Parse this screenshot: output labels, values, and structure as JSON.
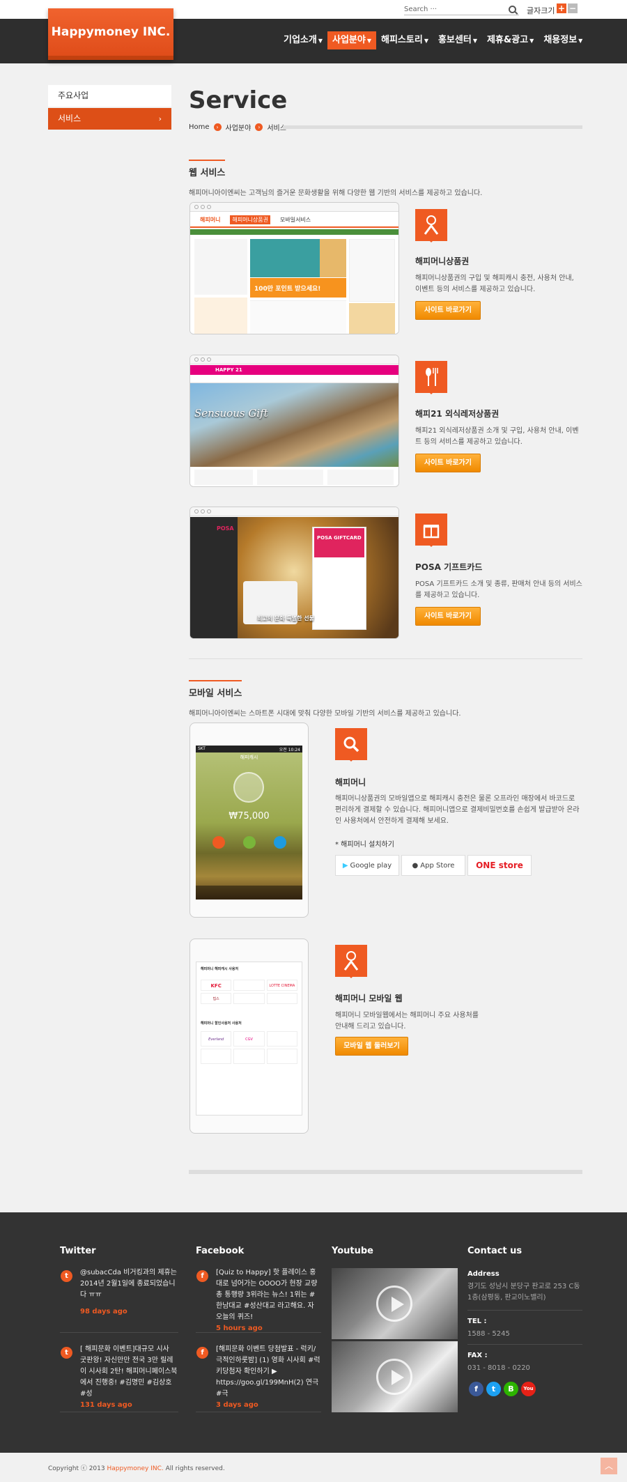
{
  "topbar": {
    "search_placeholder": "Search ···",
    "fontsize_label": "글자크기",
    "plus": "+",
    "minus": "−"
  },
  "header": {
    "logo": "Happymoney INC.",
    "nav": [
      "기업소개",
      "사업분야",
      "해피스토리",
      "홍보센터",
      "제휴&광고",
      "채용정보"
    ],
    "active_index": 1
  },
  "sidebar": {
    "items": [
      {
        "label": "주요사업"
      },
      {
        "label": "서비스"
      }
    ],
    "arrow": "›"
  },
  "page": {
    "title": "Service",
    "breadcrumb": [
      "Home",
      "사업분야",
      "서비스"
    ]
  },
  "web_section": {
    "title": "웹 서비스",
    "desc": "해피머니아이엔씨는 고객님의 즐거운 문화생활을 위해 다양한 웹 기반의 서비스를 제공하고 있습니다.",
    "services": [
      {
        "name": "해피머니상품권",
        "desc": "해피머니상품권의 구입 및 해피캐시 충전, 사용처 안내, 이벤트 등의 서비스를 제공하고 있습니다.",
        "button": "사이트 바로가기",
        "icon": "gift-person-icon",
        "shot_texts": [
          "해피머니",
          "해피머니상품권",
          "모바일서비스",
          "100만 포인트 받으세요!"
        ]
      },
      {
        "name": "해피21 외식레저상품권",
        "desc": "해피21 외식레저상품권 소개 및 구입, 사용처 안내, 이벤트 등의 서비스를 제공하고 있습니다.",
        "button": "사이트 바로가기",
        "icon": "fork-spoon-icon",
        "shot_texts": [
          "HAPPY 21",
          "Sensuous Gift"
        ]
      },
      {
        "name": "POSA 기프트카드",
        "desc": "POSA 기프트카드 소개 및 종류, 판매처 안내 등의 서비스를 제공하고 있습니다.",
        "button": "사이트 바로가기",
        "icon": "gift-box-icon",
        "shot_texts": [
          "POSA",
          "POSA GIFTCARD",
          "최고의 문화 특별한 선물"
        ]
      }
    ]
  },
  "mobile_section": {
    "title": "모바일 서비스",
    "desc": "해피머니아이엔씨는 스마트폰 시대에 맞춰 다양한 모바일 기반의 서비스를 제공하고 있습니다.",
    "app": {
      "name": "해피머니",
      "desc": "해피머니상품권의 모바일앱으로 해피캐시 충전은 물론 오프라인 매장에서 바코드로 편리하게 결제할 수 있습니다. 해피머니앱으로 결제비밀번호를 손쉽게 발급받아 온라인 사용처에서 안전하게 결제해 보세요.",
      "install_label": "* 해피머니 설치하기",
      "stores": [
        "Google play",
        "App Store",
        "ONE store"
      ],
      "phone_status": "SKT",
      "phone_time": "오전 10:24",
      "phone_title": "해피캐시",
      "phone_amount": "75,000",
      "phone_amount_prefix": "₩",
      "icon": "search-icon"
    },
    "mweb": {
      "name": "해피머니 모바일 웹",
      "desc": "해피머니 모바일웹에서는 해피머니 주요 사용처를 안내해 드리고 있습니다.",
      "button": "모바일 웹 둘러보기",
      "icon": "gift-person-icon",
      "shot_texts": [
        "해피머니 해피캐시 사용처",
        "KFC",
        "LOTTE CINEMA",
        "빕스",
        "해피머니 할인사용처 사용처",
        "Everland",
        "CGV"
      ]
    }
  },
  "footer": {
    "twitter": {
      "title": "Twitter",
      "items": [
        {
          "text": "@subacCda 비거킹과의 제휴는 2014년 2월1일에 종료되었습니다 ㅠㅠ",
          "ago": "98 days ago"
        },
        {
          "text": "[ 해피문화 이벤트]대규모 시사 굿판왕! 자신만만 전국 3만 릴레이 시사회 2탄! 해피머니페이스북에서 진행중! #김명민 #김상호 #성",
          "ago": "131 days ago"
        }
      ]
    },
    "facebook": {
      "title": "Facebook",
      "items": [
        {
          "text": "[Quiz to Happy] 핫 플레이스 홍대로 넘어가는 OOOO가 현장 교량 총 통행량 3위라는 뉴스! 1위는 #한남대교 #성산대교 라고해요. 자 오늘의 퀴즈!",
          "ago": "5 hours ago"
        },
        {
          "text": "[해피문화 이벤트 당첨발표 - 럭키/ 극적인하룻밤] (1) 영화 시사회 #럭키당첨자 확인하기 ▶ https://goo.gl/199MnH(2) 연극 #극",
          "ago": "3 days ago"
        }
      ]
    },
    "youtube": {
      "title": "Youtube"
    },
    "contact": {
      "title": "Contact us",
      "address_label": "Address",
      "address": "경기도 성남시 분당구 판교로 253 C동 1층(삼평동, 판교이노밸리)",
      "tel_label": "TEL :",
      "tel": "1588 - 5245",
      "fax_label": "FAX :",
      "fax": "031 - 8018 - 0220"
    },
    "social": [
      "f",
      "t",
      "B",
      "You"
    ],
    "copyright_prefix": "Copyright ⓒ 2013 ",
    "copyright_brand": "Happymoney INC.",
    "copyright_suffix": " All rights reserved.",
    "totop": "︿"
  },
  "colors": {
    "accent": "#ef5a22",
    "button_orange": "#f6a01a",
    "header_bg": "#2e2e2e",
    "footer_bg": "#333333"
  }
}
